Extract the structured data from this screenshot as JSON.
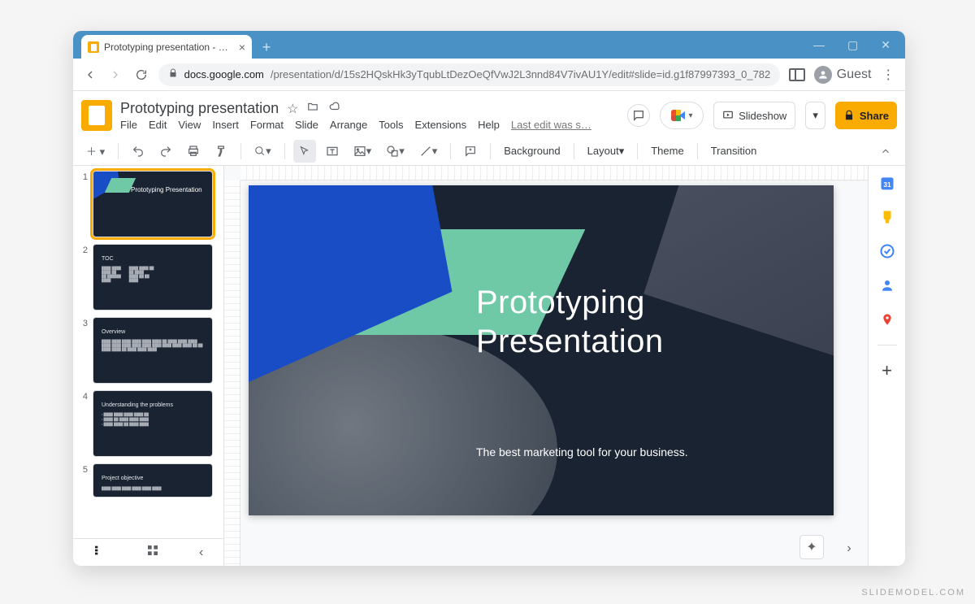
{
  "watermark": "SLIDEMODEL.COM",
  "browser": {
    "tab_title": "Prototyping presentation - Goog",
    "guest_label": "Guest",
    "url_host": "docs.google.com",
    "url_path": "/presentation/d/15s2HQskHk3yTqubLtDezOeQfVwJ2L3nnd84V7ivAU1Y/edit#slide=id.g1f87997393_0_782"
  },
  "app": {
    "doc_title": "Prototyping presentation",
    "last_edit": "Last edit was s…",
    "menus": [
      "File",
      "Edit",
      "View",
      "Insert",
      "Format",
      "Slide",
      "Arrange",
      "Tools",
      "Extensions",
      "Help"
    ],
    "slideshow": "Slideshow",
    "share": "Share"
  },
  "toolbar": {
    "background": "Background",
    "layout": "Layout",
    "theme": "Theme",
    "transition": "Transition"
  },
  "slides": [
    {
      "n": "1",
      "title": "Prototyping Presentation",
      "type": "title"
    },
    {
      "n": "2",
      "title": "TOC",
      "type": "toc"
    },
    {
      "n": "3",
      "title": "Overview",
      "type": "text"
    },
    {
      "n": "4",
      "title": "Understanding the problems",
      "type": "text"
    },
    {
      "n": "5",
      "title": "Project objective",
      "type": "text"
    }
  ],
  "main_slide": {
    "title": "Prototyping\nPresentation",
    "subtitle": "The best marketing tool for your business."
  }
}
